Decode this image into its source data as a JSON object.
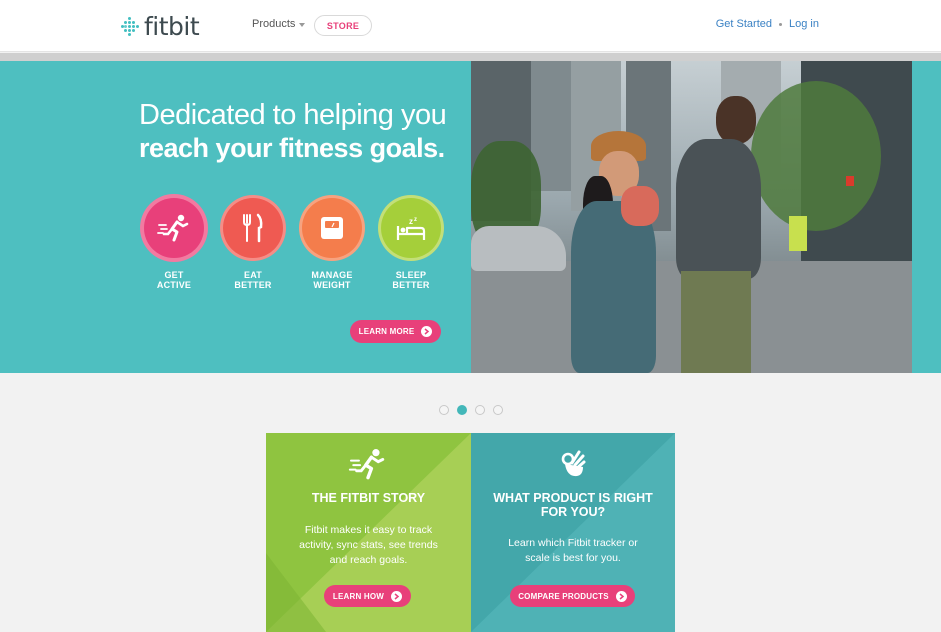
{
  "header": {
    "logo_text": "fitbit",
    "nav_products": "Products",
    "store_label": "STORE",
    "get_started": "Get Started",
    "log_in": "Log in"
  },
  "hero": {
    "title_line1": "Dedicated to helping you",
    "title_line2": "reach your fitness goals.",
    "goals": [
      {
        "line1": "GET",
        "line2": "ACTIVE",
        "icon": "running-person-icon",
        "color": "#e8407a"
      },
      {
        "line1": "EAT",
        "line2": "BETTER",
        "icon": "fork-knife-icon",
        "color": "#ef5a52"
      },
      {
        "line1": "MANAGE",
        "line2": "WEIGHT",
        "icon": "scale-icon",
        "color": "#f47d4c"
      },
      {
        "line1": "SLEEP",
        "line2": "BETTER",
        "icon": "bed-icon",
        "color": "#a5cf3a"
      }
    ],
    "learn_more": "LEARN MORE"
  },
  "carousel": {
    "slides": 4,
    "active_index": 2
  },
  "cards": {
    "story": {
      "title": "THE FITBIT STORY",
      "text_lines": [
        "Fitbit makes it easy to track",
        "activity, sync stats, see trends",
        "and reach goals."
      ],
      "button": "LEARN HOW",
      "color": "#8fc440"
    },
    "product": {
      "title_lines": [
        "WHAT PRODUCT IS RIGHT",
        "FOR YOU?"
      ],
      "text_lines": [
        "Learn which Fitbit tracker or",
        "scale is best for you."
      ],
      "button": "COMPARE PRODUCTS",
      "color": "#43a7aa"
    }
  },
  "colors": {
    "brand_teal": "#4ebfc0",
    "accent_pink": "#e8407a",
    "link_blue": "#3b82c4"
  }
}
